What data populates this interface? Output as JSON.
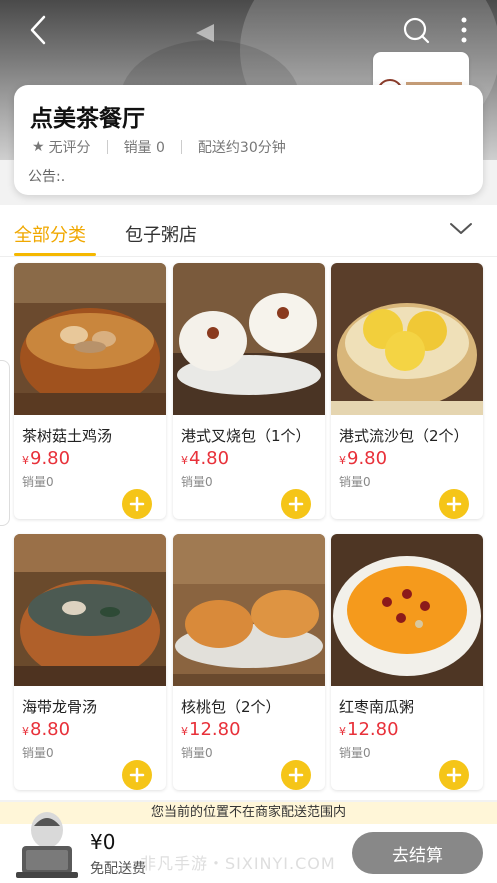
{
  "store": {
    "name": "点美茶餐厅",
    "rating": "无评分",
    "sales": "销量 0",
    "delivery": "配送约30分钟",
    "notice": "公告:."
  },
  "tabs": [
    {
      "label": "全部分类",
      "active": true
    },
    {
      "label": "包子粥店",
      "active": false
    }
  ],
  "currency_symbol": "¥",
  "products": [
    {
      "name": "茶树菇土鸡汤",
      "price": "9.80",
      "sales": "销量0"
    },
    {
      "name": "港式叉烧包（1个）",
      "price": "4.80",
      "sales": "销量0"
    },
    {
      "name": "港式流沙包（2个）",
      "price": "9.80",
      "sales": "销量0"
    },
    {
      "name": "海带龙骨汤",
      "price": "8.80",
      "sales": "销量0"
    },
    {
      "name": "核桃包（2个）",
      "price": "12.80",
      "sales": "销量0"
    },
    {
      "name": "红枣南瓜粥",
      "price": "12.80",
      "sales": "销量0"
    }
  ],
  "warning": "您当前的位置不在商家配送范围内",
  "cart": {
    "total": "¥0",
    "shipping": "免配送费",
    "checkout_label": "去结算"
  },
  "watermark": "非凡手游・SIXINYI.COM",
  "colors": {
    "accent": "#f5b800",
    "price": "#e8313a",
    "add": "#f5c518",
    "checkout": "#888888"
  },
  "icons": [
    "back-icon",
    "search-icon",
    "more-icon",
    "star-icon",
    "chevron-down-icon",
    "plus-icon"
  ]
}
